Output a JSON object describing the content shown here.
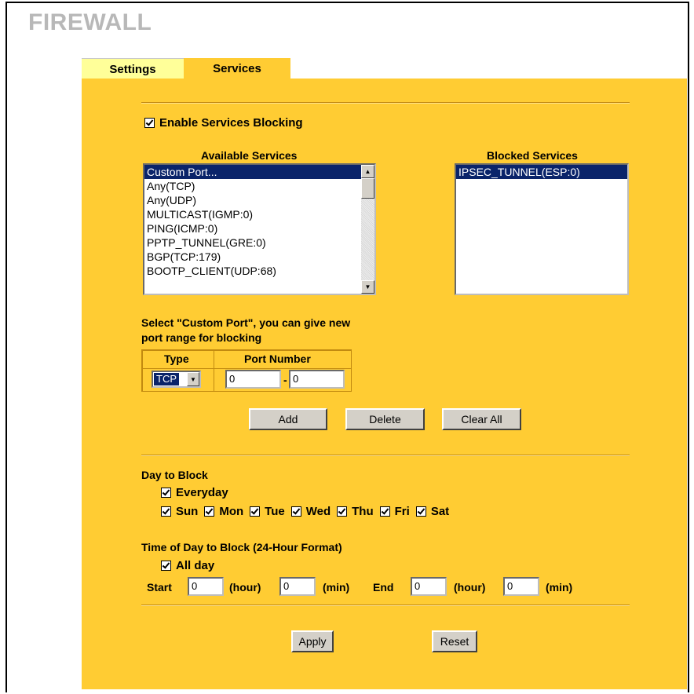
{
  "page": {
    "title": "FIREWALL"
  },
  "tabs": [
    {
      "label": "Settings"
    },
    {
      "label": "Services"
    }
  ],
  "enable_blocking": {
    "label": "Enable Services Blocking",
    "checked": true
  },
  "available": {
    "heading": "Available Services",
    "items": [
      "Custom Port...",
      "Any(TCP)",
      "Any(UDP)",
      "MULTICAST(IGMP:0)",
      "PING(ICMP:0)",
      "PPTP_TUNNEL(GRE:0)",
      "BGP(TCP:179)",
      "BOOTP_CLIENT(UDP:68)"
    ],
    "selected": "Custom Port..."
  },
  "blocked": {
    "heading": "Blocked Services",
    "items": [
      "IPSEC_TUNNEL(ESP:0)"
    ],
    "selected": "IPSEC_TUNNEL(ESP:0)"
  },
  "custom_port": {
    "note_line1": "Select \"Custom Port\", you can give new",
    "note_line2": "port range for blocking",
    "type_header": "Type",
    "port_header": "Port Number",
    "type_value": "TCP",
    "port_start": "0",
    "port_sep": "-",
    "port_end": "0"
  },
  "buttons": {
    "add": "Add",
    "delete": "Delete",
    "clear_all": "Clear All",
    "apply": "Apply",
    "reset": "Reset"
  },
  "day_block": {
    "heading": "Day to Block",
    "everyday": {
      "label": "Everyday",
      "checked": true
    },
    "days": [
      "Sun",
      "Mon",
      "Tue",
      "Wed",
      "Thu",
      "Fri",
      "Sat"
    ]
  },
  "time_block": {
    "heading": "Time of Day to Block (24-Hour Format)",
    "all_day": {
      "label": "All day",
      "checked": true
    },
    "start_label": "Start",
    "end_label": "End",
    "hour_label": "(hour)",
    "min_label": "(min)",
    "start_hour": "0",
    "start_min": "0",
    "end_hour": "0",
    "end_min": "0"
  },
  "colors": {
    "panel": "#ffcc33",
    "settings_tab": "#ffff99",
    "selection": "#0a246a",
    "title": "#b8b8b8"
  }
}
